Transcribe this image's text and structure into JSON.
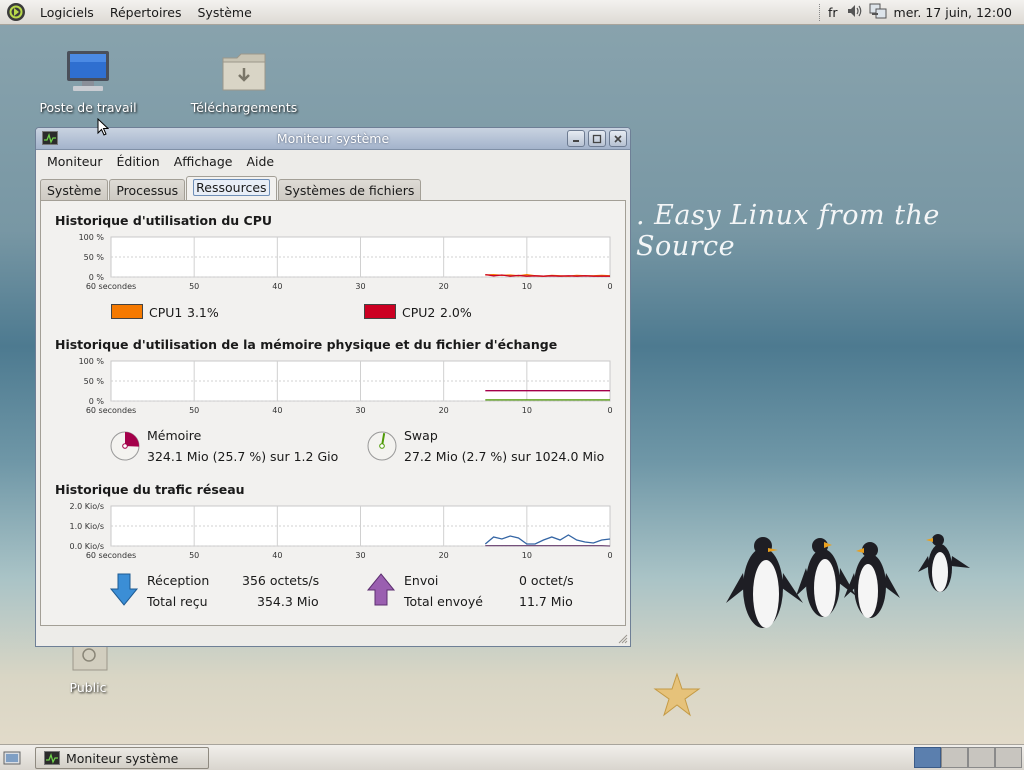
{
  "top_panel": {
    "menus": [
      "Logiciels",
      "Répertoires",
      "Système"
    ],
    "keyboard_layout": "fr",
    "datetime": "mer. 17 juin, 12:00"
  },
  "desktop": {
    "icons": [
      "Poste de travail",
      "Téléchargements",
      "Public"
    ],
    "tagline": ". Easy Linux from the Source"
  },
  "window": {
    "title": "Moniteur système",
    "menus": [
      "Moniteur",
      "Édition",
      "Affichage",
      "Aide"
    ],
    "tabs": [
      "Système",
      "Processus",
      "Ressources",
      "Systèmes de fichiers"
    ],
    "active_tab": "Ressources",
    "cpu": {
      "title": "Historique d'utilisation du CPU",
      "yticks": [
        "100 %",
        "50 %",
        "0 %"
      ],
      "xticks": [
        "60 secondes",
        "50",
        "40",
        "30",
        "20",
        "10",
        "0"
      ],
      "cpu1_label": "CPU1",
      "cpu1_value": "3.1%",
      "cpu1_color": "#f57900",
      "cpu2_label": "CPU2",
      "cpu2_value": "2.0%",
      "cpu2_color": "#cc0022"
    },
    "memory": {
      "title": "Historique d'utilisation de la mémoire physique et du fichier d'échange",
      "yticks": [
        "100 %",
        "50 %",
        "0 %"
      ],
      "xticks": [
        "60 secondes",
        "50",
        "40",
        "30",
        "20",
        "10",
        "0"
      ],
      "mem_label": "Mémoire",
      "mem_value": "324.1 Mio (25.7 %) sur 1.2 Gio",
      "mem_color": "#a4004a",
      "swap_label": "Swap",
      "swap_value": "27.2 Mio (2.7 %) sur 1024.0 Mio",
      "swap_color": "#4e9a06"
    },
    "network": {
      "title": "Historique du trafic réseau",
      "yticks": [
        "2.0 Kio/s",
        "1.0 Kio/s",
        "0.0 Kio/s"
      ],
      "xticks": [
        "60 secondes",
        "50",
        "40",
        "30",
        "20",
        "10",
        "0"
      ],
      "rx_label": "Réception",
      "rx_rate": "356 octets/s",
      "rx_total_label": "Total reçu",
      "rx_total": "354.3 Mio",
      "rx_color": "#3465a4",
      "tx_label": "Envoi",
      "tx_rate": "0 octet/s",
      "tx_total_label": "Total envoyé",
      "tx_total": "11.7 Mio",
      "tx_color": "#75507b"
    }
  },
  "chart_data": [
    {
      "type": "line",
      "title": "Historique d'utilisation du CPU",
      "xlabel": "",
      "ylabel": "",
      "x": [
        15,
        14,
        13,
        12,
        11,
        10,
        9,
        8,
        7,
        6,
        5,
        4,
        3,
        2,
        1,
        0
      ],
      "xlim": [
        60,
        0
      ],
      "ylim": [
        0,
        100
      ],
      "series": [
        {
          "name": "CPU1",
          "values": [
            5,
            6,
            4,
            5,
            3,
            6,
            3,
            2,
            4,
            3,
            2,
            4,
            3,
            3,
            4,
            3.1
          ]
        },
        {
          "name": "CPU2",
          "values": [
            6,
            3,
            5,
            2,
            4,
            2,
            3,
            2,
            3,
            2,
            3,
            2,
            3,
            2,
            2,
            2.0
          ]
        }
      ]
    },
    {
      "type": "line",
      "title": "Historique d'utilisation de la mémoire physique et du fichier d'échange",
      "xlabel": "",
      "ylabel": "",
      "x": [
        15,
        0
      ],
      "xlim": [
        60,
        0
      ],
      "ylim": [
        0,
        100
      ],
      "series": [
        {
          "name": "Mémoire",
          "values": [
            25.7,
            25.7
          ]
        },
        {
          "name": "Swap",
          "values": [
            2.7,
            2.7
          ]
        }
      ]
    },
    {
      "type": "line",
      "title": "Historique du trafic réseau",
      "xlabel": "",
      "ylabel": "",
      "x": [
        15,
        14,
        13,
        12,
        11,
        10,
        9,
        8,
        7,
        6,
        5,
        4,
        3,
        2,
        1,
        0
      ],
      "xlim": [
        60,
        0
      ],
      "ylim": [
        0,
        2.0
      ],
      "series": [
        {
          "name": "Réception",
          "values": [
            0.1,
            0.45,
            0.35,
            0.5,
            0.4,
            0.1,
            0.1,
            0.3,
            0.45,
            0.3,
            0.55,
            0.3,
            0.2,
            0.15,
            0.3,
            0.35
          ]
        },
        {
          "name": "Envoi",
          "values": [
            0.02,
            0.02,
            0.02,
            0.02,
            0.02,
            0.02,
            0.02,
            0.02,
            0.02,
            0.02,
            0.02,
            0.02,
            0.02,
            0.02,
            0.02,
            0.0
          ]
        }
      ]
    }
  ]
}
